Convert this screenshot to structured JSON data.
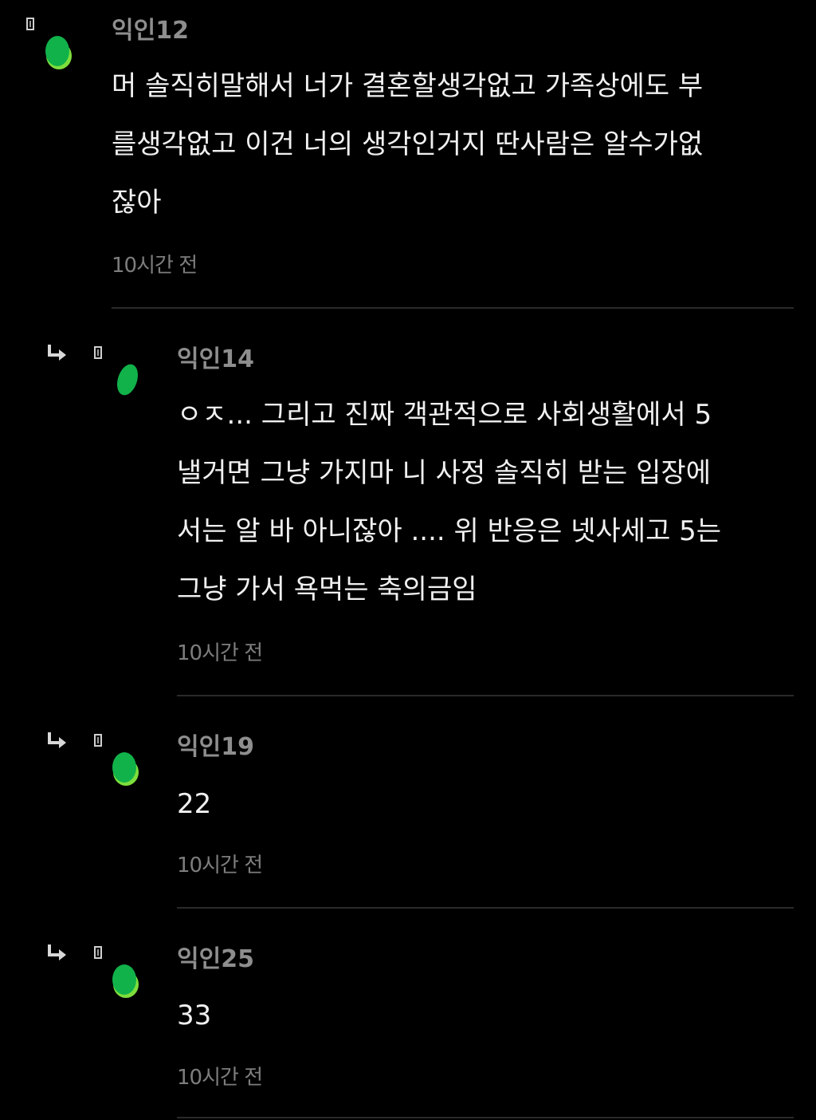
{
  "colors": {
    "background": "#000000",
    "nickname": "#8e8e8e",
    "text": "#f0f0f0",
    "timestamp": "#7d7d7d",
    "divider": "#2a2a2a",
    "avatar_dark": "#11b24a",
    "avatar_light": "#7dde3c"
  },
  "comments": [
    {
      "nickname": "익인12",
      "body": "머 솔직히말해서 너가 결혼할생각없고 가족상에도 부\n를생각없고 이건 너의 생각인거지 딴사람은 알수가없\n잖아",
      "time": "10시간 전",
      "is_reply": false,
      "icon": "green-leaf-avatar"
    },
    {
      "nickname": "익인14",
      "body": "ㅇㅈ... 그리고 진짜 객관적으로 사회생활에서 5\n낼거면 그냥 가지마 니 사정 솔직히 받는 입장에\n서는 알 바 아니잖아 .... 위 반응은 넷사세고 5는\n그냥 가서 욕먹는 축의금임",
      "time": "10시간 전",
      "is_reply": true,
      "icon": "green-leaf-avatar"
    },
    {
      "nickname": "익인19",
      "body": "22",
      "time": "10시간 전",
      "is_reply": true,
      "icon": "green-leaf-avatar"
    },
    {
      "nickname": "익인25",
      "body": "33",
      "time": "10시간 전",
      "is_reply": true,
      "icon": "green-leaf-avatar"
    }
  ]
}
